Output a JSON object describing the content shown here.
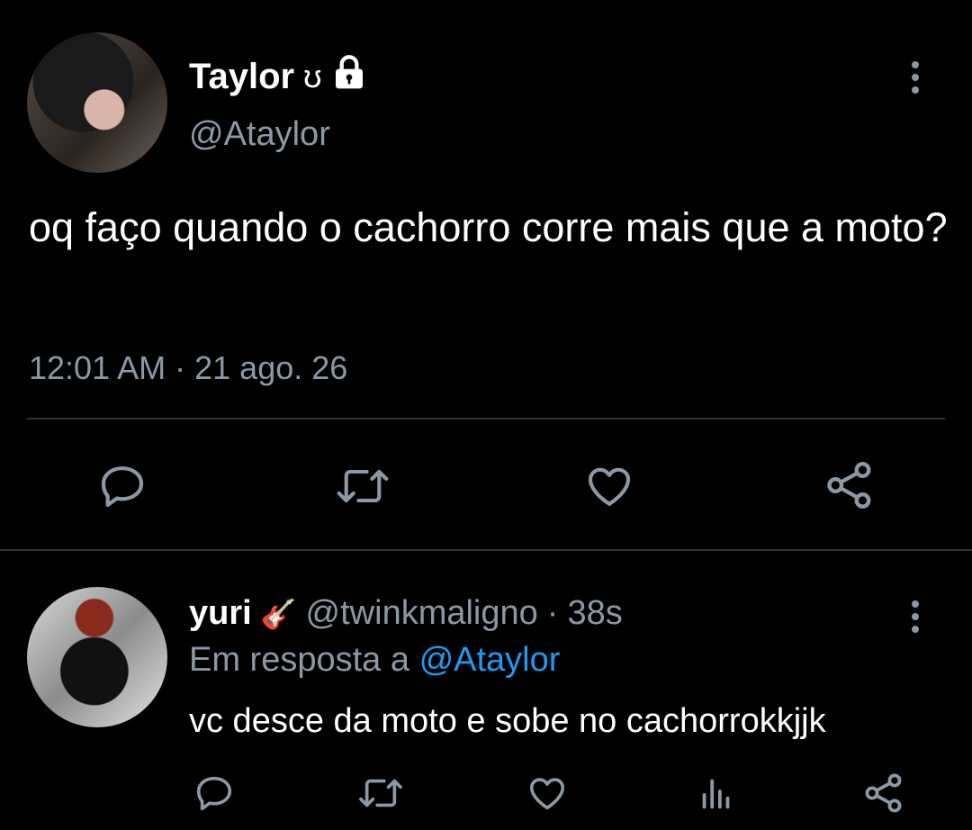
{
  "tweet": {
    "display_name": "Taylor",
    "name_emoji": "ʊ",
    "handle": "@Ataylor",
    "text": "oq faço quando o cachorro corre mais que a moto?",
    "time": "12:01 AM",
    "separator": "·",
    "date": "21 ago. 26"
  },
  "tweet_actions": [
    "reply-icon",
    "retweet-icon",
    "like-icon",
    "share-icon"
  ],
  "reply": {
    "display_name": "yuri",
    "name_emoji": "🎸",
    "handle": "@twinkmaligno",
    "separator": "·",
    "age": "38s",
    "reply_prefix": "Em resposta a",
    "reply_to": "@Ataylor",
    "text": "vc desce da moto e sobe no cachorrokkjjk"
  },
  "reply_actions": [
    "reply-icon",
    "retweet-icon",
    "like-icon",
    "analytics-icon",
    "share-icon"
  ],
  "colors": {
    "background": "#000000",
    "text": "#ffffff",
    "secondary": "#8b98a5",
    "link": "#1d9bf0",
    "divider": "#2f3336"
  }
}
